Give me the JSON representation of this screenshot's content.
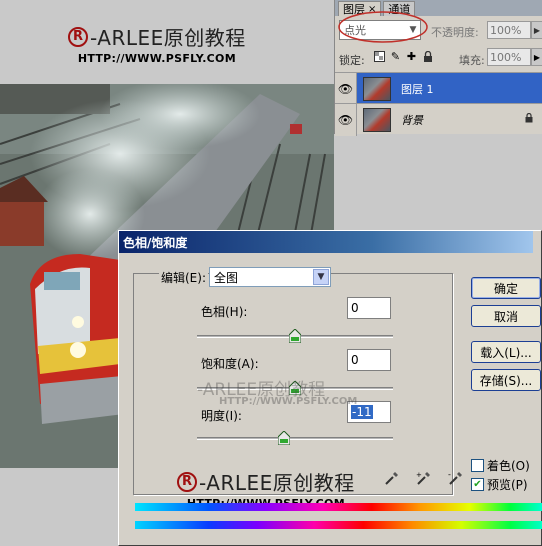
{
  "watermark": {
    "reg_symbol": "R",
    "name": "-ARLEE原创教程",
    "url": "HTTP://WWW.PSFLY.COM"
  },
  "layers_panel": {
    "tabs": [
      {
        "label": "图层",
        "close": "×"
      },
      {
        "label": "通道"
      }
    ],
    "blend_mode": "点光",
    "opacity_label": "不透明度:",
    "opacity_value": "100%",
    "lock_label": "锁定:",
    "fill_label": "填充:",
    "fill_value": "100%",
    "layers": [
      {
        "name": "图层 1",
        "selected": true
      },
      {
        "name": "背景",
        "selected": false,
        "locked": true
      }
    ]
  },
  "dialog": {
    "title": "色相/饱和度",
    "edit_label": "编辑(E):",
    "edit_value": "全图",
    "params": [
      {
        "label": "色相(H):",
        "value": "0",
        "level": 0
      },
      {
        "label": "饱和度(A):",
        "value": "0",
        "level": 0
      },
      {
        "label": "明度(I):",
        "value": "-11",
        "level": -11
      }
    ],
    "buttons": {
      "ok": "确定",
      "cancel": "取消",
      "load": "载入(L)...",
      "save": "存储(S)..."
    },
    "colorize": {
      "label": "着色(O)",
      "checked": false
    },
    "preview": {
      "label": "预览(P)",
      "checked": true
    }
  },
  "colors": {
    "selection": "#3163c5",
    "title_start": "#0a246a",
    "brand_red": "#a01010"
  }
}
